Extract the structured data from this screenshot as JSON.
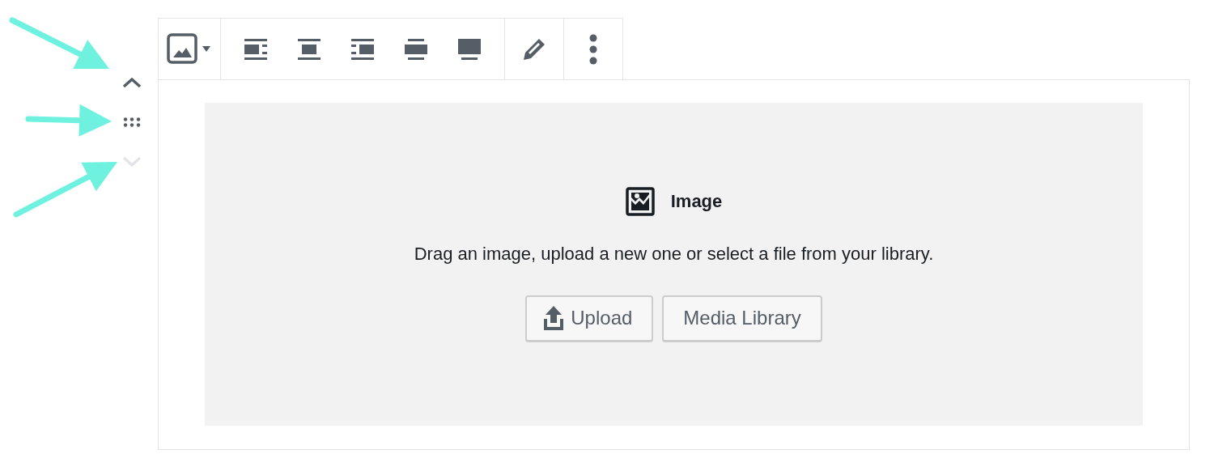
{
  "annotations": [
    {
      "kind": "arrow",
      "color": "#6ef2df"
    },
    {
      "kind": "arrow",
      "color": "#6ef2df"
    },
    {
      "kind": "arrow",
      "color": "#6ef2df"
    }
  ],
  "mover": [
    {
      "kind": "up",
      "disabled": false
    },
    {
      "kind": "drag",
      "disabled": false
    },
    {
      "kind": "down",
      "disabled": true
    }
  ],
  "toolbar": {
    "groups": [
      {
        "tools": [
          {
            "kind": "image-switcher"
          }
        ]
      },
      {
        "tools": [
          {
            "kind": "align-left"
          },
          {
            "kind": "align-center"
          },
          {
            "kind": "align-right"
          },
          {
            "kind": "wide"
          },
          {
            "kind": "full"
          }
        ]
      },
      {
        "tools": [
          {
            "kind": "edit"
          }
        ]
      },
      {
        "tools": [
          {
            "kind": "more"
          }
        ]
      }
    ]
  },
  "placeholder": {
    "title": "Image",
    "instructions": "Drag an image, upload a new one or select a file from your library.",
    "buttons": [
      {
        "kind": "upload",
        "label": "Upload"
      },
      {
        "kind": "plain",
        "label": "Media Library"
      }
    ]
  }
}
